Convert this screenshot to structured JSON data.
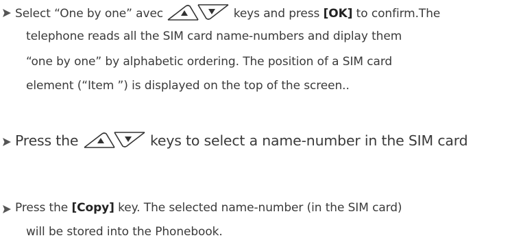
{
  "steps": [
    {
      "line1": {
        "before_keys": "Select “One by one” avec",
        "after_keys": "keys and press",
        "bold": "[OK]",
        "after_bold": "to confirm.The"
      },
      "line2": "telephone reads all the SIM card name-numbers and diplay them",
      "line3": "“one by one” by alphabetic ordering. The position of  a SIM card",
      "line4": "element (“Item ”) is displayed on the top of the screen.."
    },
    {
      "before_keys": "Press the",
      "after_keys": "keys to select a name-number in the SIM card"
    },
    {
      "line1": {
        "before_bold": "Press the",
        "bold": "[Copy]",
        "after_bold": "key. The selected name-number (in the SIM card)"
      },
      "line2": "will be stored into the Phonebook."
    }
  ],
  "icons": {
    "bullet": "triangle-bullet-icon",
    "keys": "up-down-arrow-keys-icon"
  },
  "colors": {
    "text": "#3a3a3a",
    "bullet": "#555555"
  }
}
